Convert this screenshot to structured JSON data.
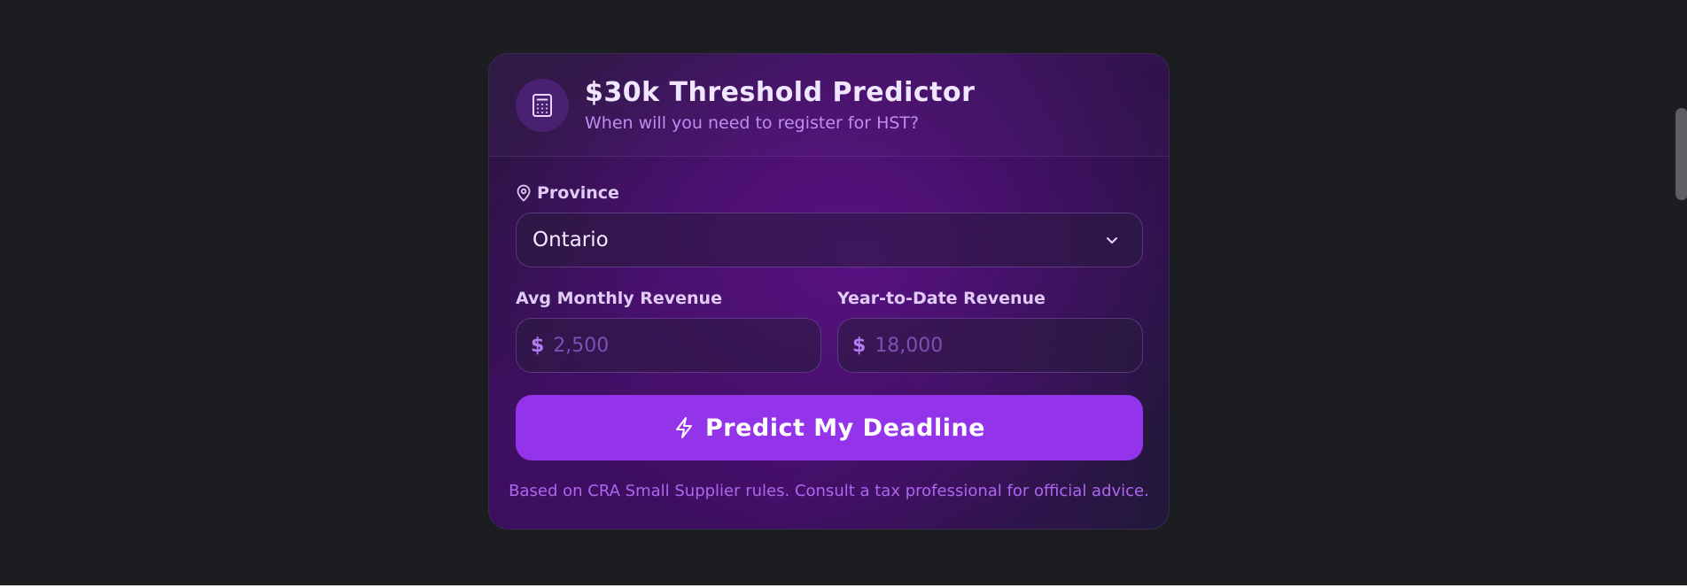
{
  "card": {
    "title": "$30k Threshold Predictor",
    "subtitle": "When will you need to register for HST?",
    "header_icon": "calculator-icon"
  },
  "province": {
    "label": "Province",
    "icon": "map-pin-icon",
    "selected": "Ontario"
  },
  "monthly_revenue": {
    "label": "Avg Monthly Revenue",
    "currency_symbol": "$",
    "placeholder": "2,500",
    "value": ""
  },
  "ytd_revenue": {
    "label": "Year-to-Date Revenue",
    "currency_symbol": "$",
    "placeholder": "18,000",
    "value": ""
  },
  "predict_button": {
    "label": "Predict My Deadline",
    "icon": "lightning-icon"
  },
  "disclaimer": "Based on CRA Small Supplier rules. Consult a tax professional for official advice.",
  "colors": {
    "page_background": "#1b1d21",
    "accent": "#9333ea",
    "label_text": "#e0cbf7",
    "subtle_purple": "#c08cf2"
  }
}
